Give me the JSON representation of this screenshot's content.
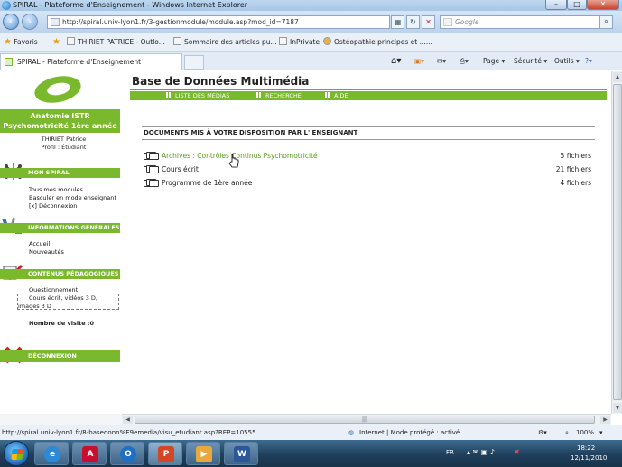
{
  "window": {
    "title": "SPIRAL - Plateforme d'Enseignement - Windows Internet Explorer",
    "minimize": "–",
    "maximize": "□",
    "close": "✕"
  },
  "address": {
    "url": "http://spiral.univ-lyon1.fr/3-gestionmodule/module.asp?mod_id=7187",
    "search_placeholder": "Google"
  },
  "favorites": {
    "label": "Favoris",
    "items": [
      "THIRIET PATRICE - Outlo...",
      "Sommaire des articles pu...",
      "InPrivate",
      "Ostéopathie principes et ......"
    ]
  },
  "tab": {
    "title": "SPIRAL - Plateforme d'Enseignement"
  },
  "commands": {
    "page": "Page ▾",
    "securite": "Sécurité ▾",
    "outils": "Outils ▾"
  },
  "sidebar": {
    "course_title_line1": "Anatomie ISTR",
    "course_title_line2": "Psychomotricité 1ère année",
    "user_name": "THIRIET Patrice",
    "user_profile": "Profil : Étudiant",
    "mon_spiral": {
      "header": "MON SPIRAL",
      "items": [
        "Tous mes modules",
        "Basculer en mode enseignant",
        "[x]  Déconnexion"
      ]
    },
    "infos": {
      "header": "INFORMATIONS GÉNÉRALES",
      "items": [
        "Accueil",
        "Nouveautés"
      ]
    },
    "contenus": {
      "header": "CONTENUS PÉDAGOGIQUES",
      "items": [
        "Questionnement"
      ],
      "sub_line1": "Cours écrit, vidéos 3 D,",
      "sub_line2": "images 3 D"
    },
    "visits": "Nombre de visite :0",
    "deconnexion": "DÉCONNEXION"
  },
  "main": {
    "title": "Base de Données Multimédia",
    "menu": [
      "LISTE DES MEDIAS",
      "RECHERCHE",
      "AIDE"
    ],
    "docs_title": "DOCUMENTS MIS À VOTRE DISPOSITION PAR L' ENSEIGNANT",
    "rows": [
      {
        "label": "Archives : Contrôles Continus Psychomotricité",
        "count": "5 fichiers"
      },
      {
        "label": "Cours écrit",
        "count": "21 fichiers"
      },
      {
        "label": "Programme de 1ère année",
        "count": "4 fichiers"
      }
    ]
  },
  "status": {
    "link": "http://spiral.univ-lyon1.fr/8-basedonn%E9emedia/visu_etudiant.asp?REP=10555",
    "zone": "Internet | Mode protégé : activé",
    "zoom": "100%"
  },
  "taskbar": {
    "lang": "FR",
    "time": "18:22",
    "date": "12/11/2010"
  },
  "colors": {
    "accent_green": "#7ab82d",
    "link_green": "#5a9a1d"
  }
}
